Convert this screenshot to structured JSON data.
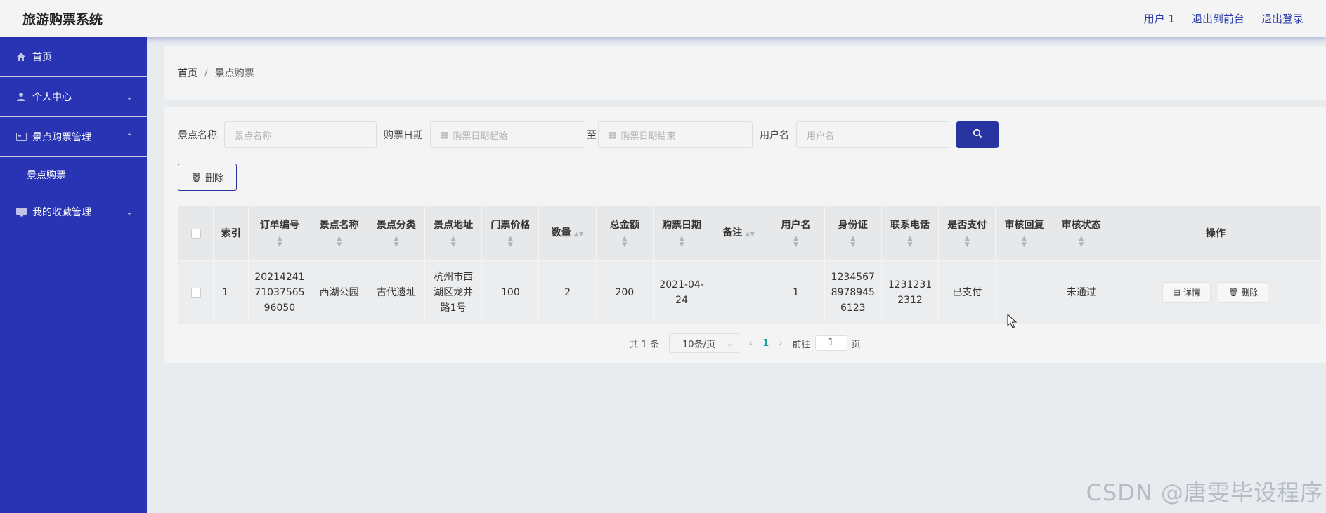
{
  "header": {
    "title": "旅游购票系统",
    "user": "用户 1",
    "back_front": "退出到前台",
    "logout": "退出登录"
  },
  "sidebar": {
    "items": [
      {
        "label": "首页",
        "icon": "home-icon"
      },
      {
        "label": "个人中心",
        "icon": "user-icon"
      },
      {
        "label": "景点购票管理",
        "icon": "card-icon"
      },
      {
        "label": "景点购票",
        "icon": ""
      },
      {
        "label": "我的收藏管理",
        "icon": "monitor-icon"
      }
    ]
  },
  "breadcrumb": {
    "home": "首页",
    "sep": "/",
    "current": "景点购票"
  },
  "search": {
    "name_label": "景点名称",
    "name_placeholder": "景点名称",
    "date_label": "购票日期",
    "date_start_placeholder": "购票日期起始",
    "to": "至",
    "date_end_placeholder": "购票日期结束",
    "user_label": "用户名",
    "user_placeholder": "用户名"
  },
  "toolbar": {
    "delete_label": "删除"
  },
  "table": {
    "headers": [
      "索引",
      "订单编号",
      "景点名称",
      "景点分类",
      "景点地址",
      "门票价格",
      "数量",
      "总金额",
      "购票日期",
      "备注",
      "用户名",
      "身份证",
      "联系电话",
      "是否支付",
      "审核回复",
      "审核状态",
      "操作"
    ],
    "rows": [
      {
        "index": "1",
        "order_no": "2021424171037565 96050",
        "spot_name": "西湖公园",
        "category": "古代遗址",
        "address": "杭州市西湖区龙井路1号",
        "price": "100",
        "quantity": "2",
        "total": "200",
        "date": "2021-04-24",
        "remark": "",
        "username": "1",
        "id_card": "123456789789456123",
        "phone": "12312312312",
        "paid": "已支付",
        "reply": "",
        "status": "未通过"
      }
    ],
    "detail_label": "详情",
    "delete_label": "删除"
  },
  "pagination": {
    "total": "共 1 条",
    "page_size": "10条/页",
    "current": "1",
    "goto_label": "前往",
    "goto_value": "1",
    "page_suffix": "页"
  },
  "watermark": "CSDN @唐雯毕设程序",
  "colors": {
    "primary": "#2834b4",
    "button": "#28349f"
  }
}
